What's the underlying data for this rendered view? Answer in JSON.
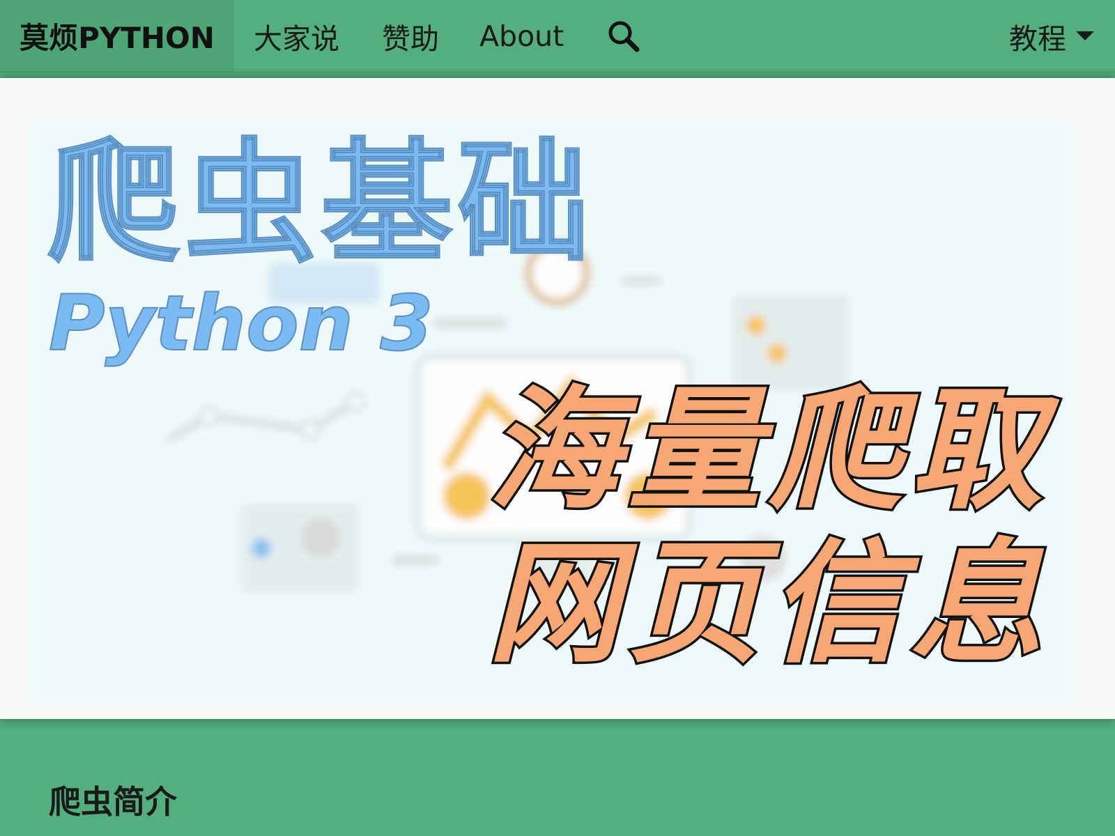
{
  "nav": {
    "brand": "莫烦PYTHON",
    "links": [
      "大家说",
      "赞助",
      "About"
    ],
    "search_icon": "search-icon",
    "tutorial_label": "教程",
    "tutorial_icon": "caret-down-icon"
  },
  "hero": {
    "title": "爬虫基础",
    "subtitle": "Python 3",
    "slogan_line1": "海量爬取",
    "slogan_line2": "网页信息",
    "colors": {
      "title": "#7bbaf2",
      "slogan_fill": "#f7a773",
      "slogan_stroke": "#111111"
    }
  },
  "section": {
    "title": "爬虫简介"
  },
  "colors": {
    "navbar": "#53b07e",
    "brand_bg": "#4ea676"
  }
}
